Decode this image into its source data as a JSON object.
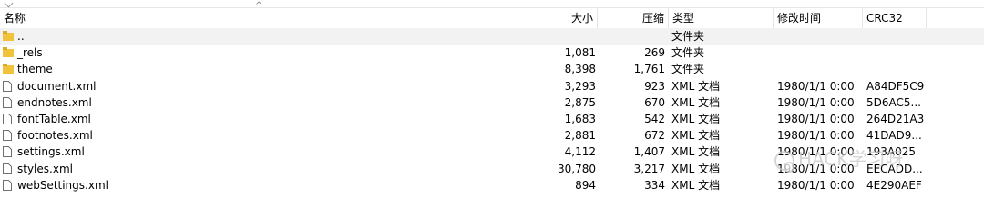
{
  "columns": {
    "name": "名称",
    "size": "大小",
    "packed": "压缩",
    "type": "类型",
    "modified": "修改时间",
    "crc": "CRC32"
  },
  "rows": [
    {
      "name": "..",
      "icon": "folder-up-icon",
      "size": "",
      "packed": "",
      "type": "文件夹",
      "modified": "",
      "crc": ""
    },
    {
      "name": "_rels",
      "icon": "folder-icon",
      "size": "1,081",
      "packed": "269",
      "type": "文件夹",
      "modified": "",
      "crc": ""
    },
    {
      "name": "theme",
      "icon": "folder-icon",
      "size": "8,398",
      "packed": "1,761",
      "type": "文件夹",
      "modified": "",
      "crc": ""
    },
    {
      "name": "document.xml",
      "icon": "file-icon",
      "size": "3,293",
      "packed": "923",
      "type": "XML 文档",
      "modified": "1980/1/1 0:00",
      "crc": "A84DF5C9"
    },
    {
      "name": "endnotes.xml",
      "icon": "file-icon",
      "size": "2,875",
      "packed": "670",
      "type": "XML 文档",
      "modified": "1980/1/1 0:00",
      "crc": "5D6AC5..."
    },
    {
      "name": "fontTable.xml",
      "icon": "file-icon",
      "size": "1,683",
      "packed": "542",
      "type": "XML 文档",
      "modified": "1980/1/1 0:00",
      "crc": "264D21A3"
    },
    {
      "name": "footnotes.xml",
      "icon": "file-icon",
      "size": "2,881",
      "packed": "672",
      "type": "XML 文档",
      "modified": "1980/1/1 0:00",
      "crc": "41DAD9..."
    },
    {
      "name": "settings.xml",
      "icon": "file-icon",
      "size": "4,112",
      "packed": "1,407",
      "type": "XML 文档",
      "modified": "1980/1/1 0:00",
      "crc": "193A025"
    },
    {
      "name": "styles.xml",
      "icon": "file-icon",
      "size": "30,780",
      "packed": "3,217",
      "type": "XML 文档",
      "modified": "1980/1/1 0:00",
      "crc": "EECADD..."
    },
    {
      "name": "webSettings.xml",
      "icon": "file-icon",
      "size": "894",
      "packed": "334",
      "type": "XML 文档",
      "modified": "1980/1/1 0:00",
      "crc": "4E290AEF"
    }
  ],
  "watermark": "HACK学习呀",
  "colors": {
    "folder": "#f3c23b",
    "folder_tab": "#e0a82a",
    "file_border": "#707070",
    "selected_row": "#f2f2f2"
  }
}
